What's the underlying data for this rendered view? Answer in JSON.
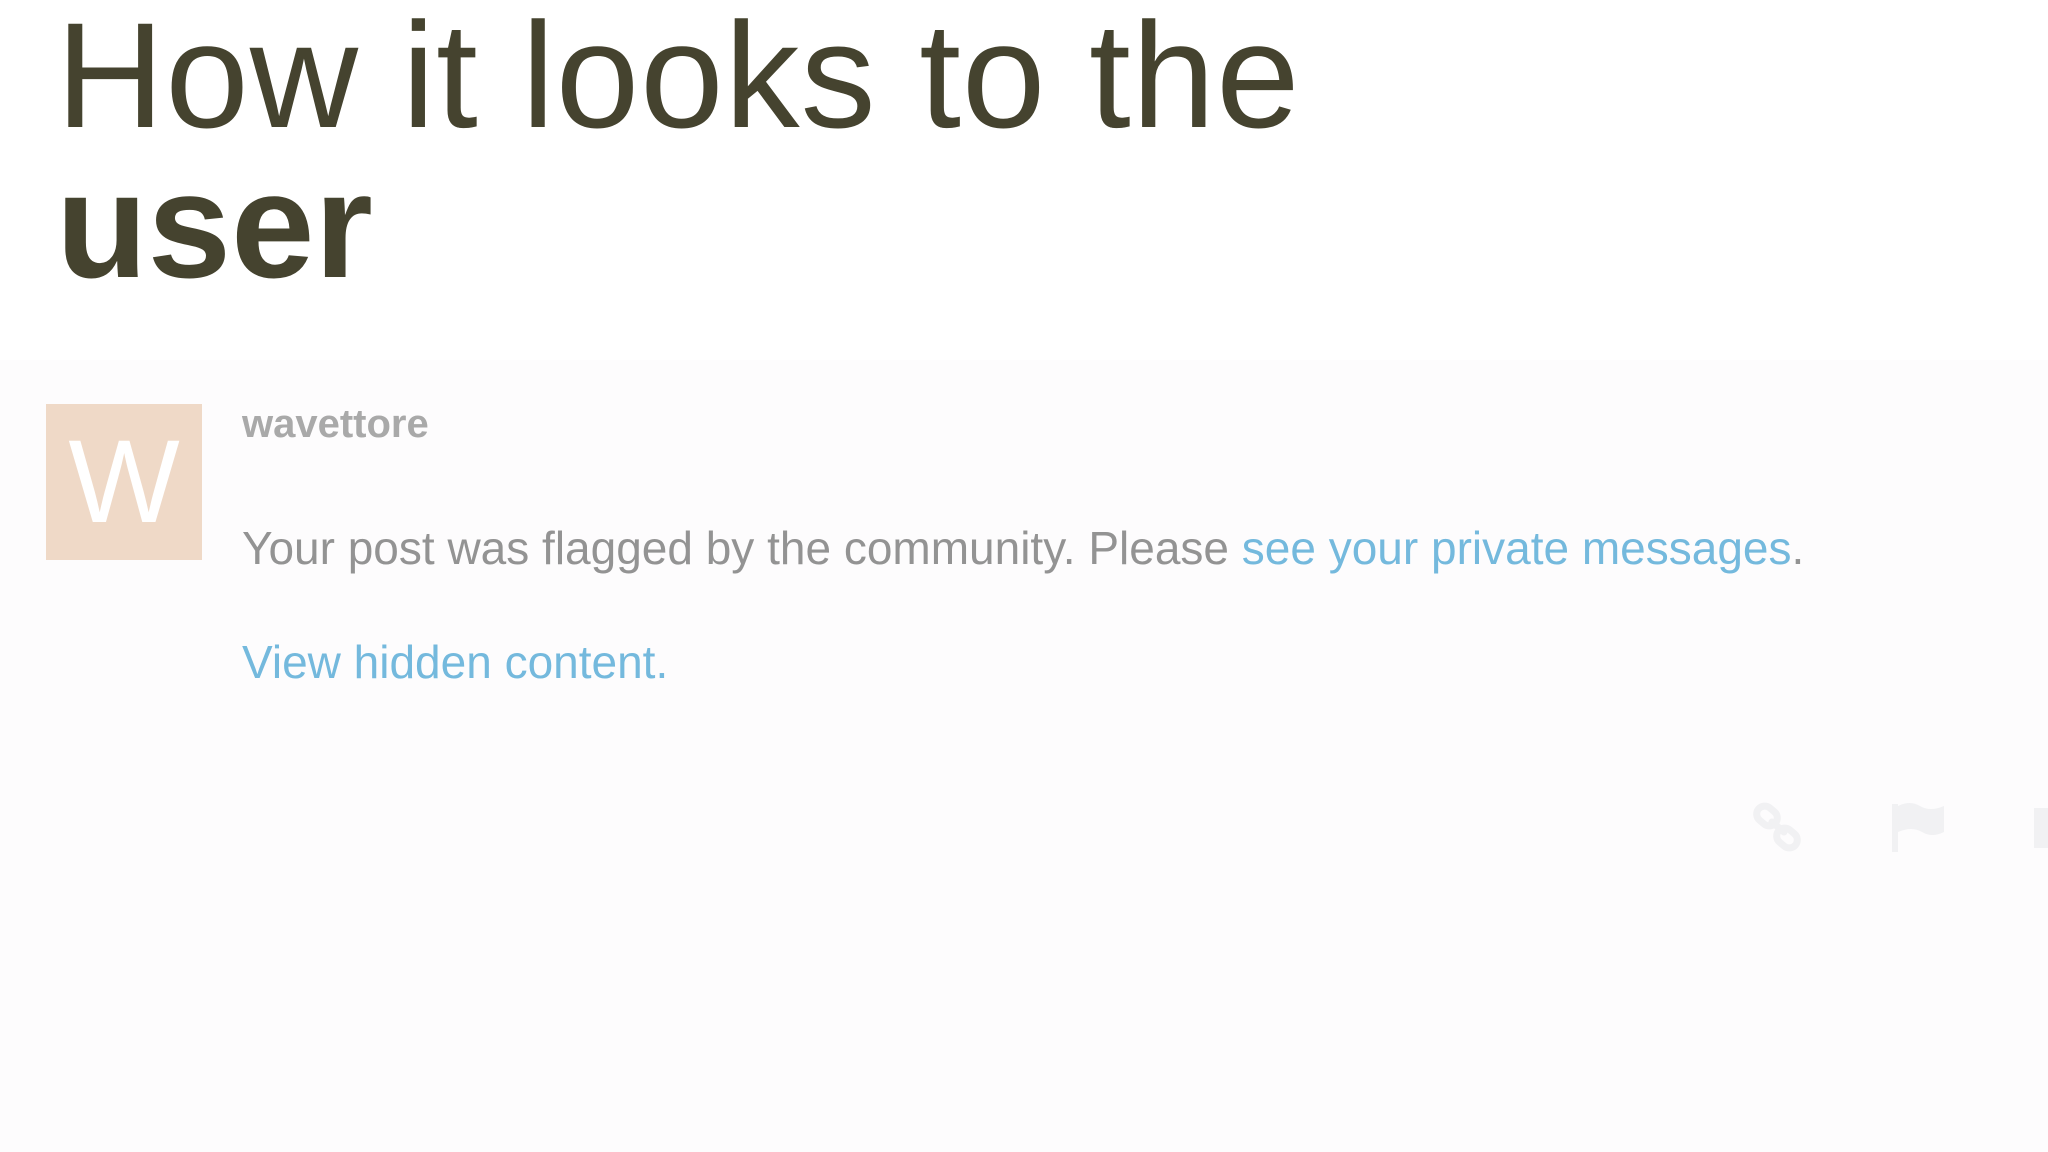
{
  "slide": {
    "title_line1": "How it looks to the",
    "title_line2": "user"
  },
  "post": {
    "avatar_letter": "W",
    "avatar_color": "#efd9c7",
    "username": "wavettore",
    "notice_text": "Your post was flagged by the community. Please ",
    "notice_link": "see your private messages",
    "notice_end": ".",
    "hidden_link": "View hidden content.",
    "link_color": "#74b9dd",
    "actions": [
      {
        "icon": "link-icon"
      },
      {
        "icon": "flag-icon"
      },
      {
        "icon": "bookmark-icon"
      }
    ]
  }
}
